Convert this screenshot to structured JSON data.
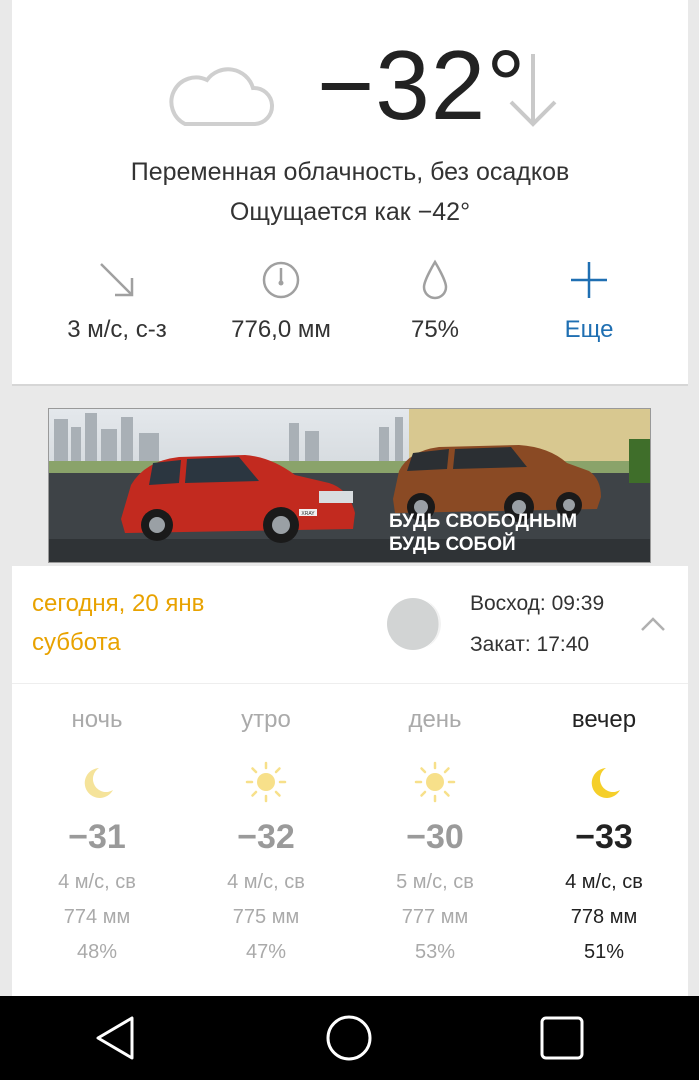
{
  "current": {
    "temperature": "−32°",
    "condition": "Переменная облачность, без осадков",
    "feels_like": "Ощущается как −42°",
    "wind": "3 м/с, с-з",
    "pressure": "776,0 мм",
    "humidity": "75%",
    "more_label": "Еще"
  },
  "ad": {
    "line1": "БУДЬ СВОБОДНЫМ",
    "line2": "БУДЬ СОБОЙ",
    "plate": "ХRAY"
  },
  "today": {
    "date": "сегодня, 20 янв",
    "weekday": "суббота",
    "sunrise": "Восход: 09:39",
    "sunset": "Закат: 17:40",
    "periods": [
      {
        "name": "ночь",
        "temp": "−31",
        "wind": "4 м/с, св",
        "pressure": "774 мм",
        "humidity": "48%",
        "icon": "moon-icon"
      },
      {
        "name": "утро",
        "temp": "−32",
        "wind": "4 м/с, св",
        "pressure": "775 мм",
        "humidity": "47%",
        "icon": "sun-icon"
      },
      {
        "name": "день",
        "temp": "−30",
        "wind": "5 м/с, св",
        "pressure": "777 мм",
        "humidity": "53%",
        "icon": "sun-icon"
      },
      {
        "name": "вечер",
        "temp": "−33",
        "wind": "4 м/с, св",
        "pressure": "778 мм",
        "humidity": "51%",
        "icon": "moon-icon"
      }
    ]
  },
  "colors": {
    "accent_orange": "#e8a200",
    "link_blue": "#1f6fb2",
    "sun_yellow": "#f5cf2a"
  },
  "navbar": {
    "icons": [
      "back-triangle-icon",
      "home-circle-icon",
      "recents-square-icon"
    ]
  }
}
